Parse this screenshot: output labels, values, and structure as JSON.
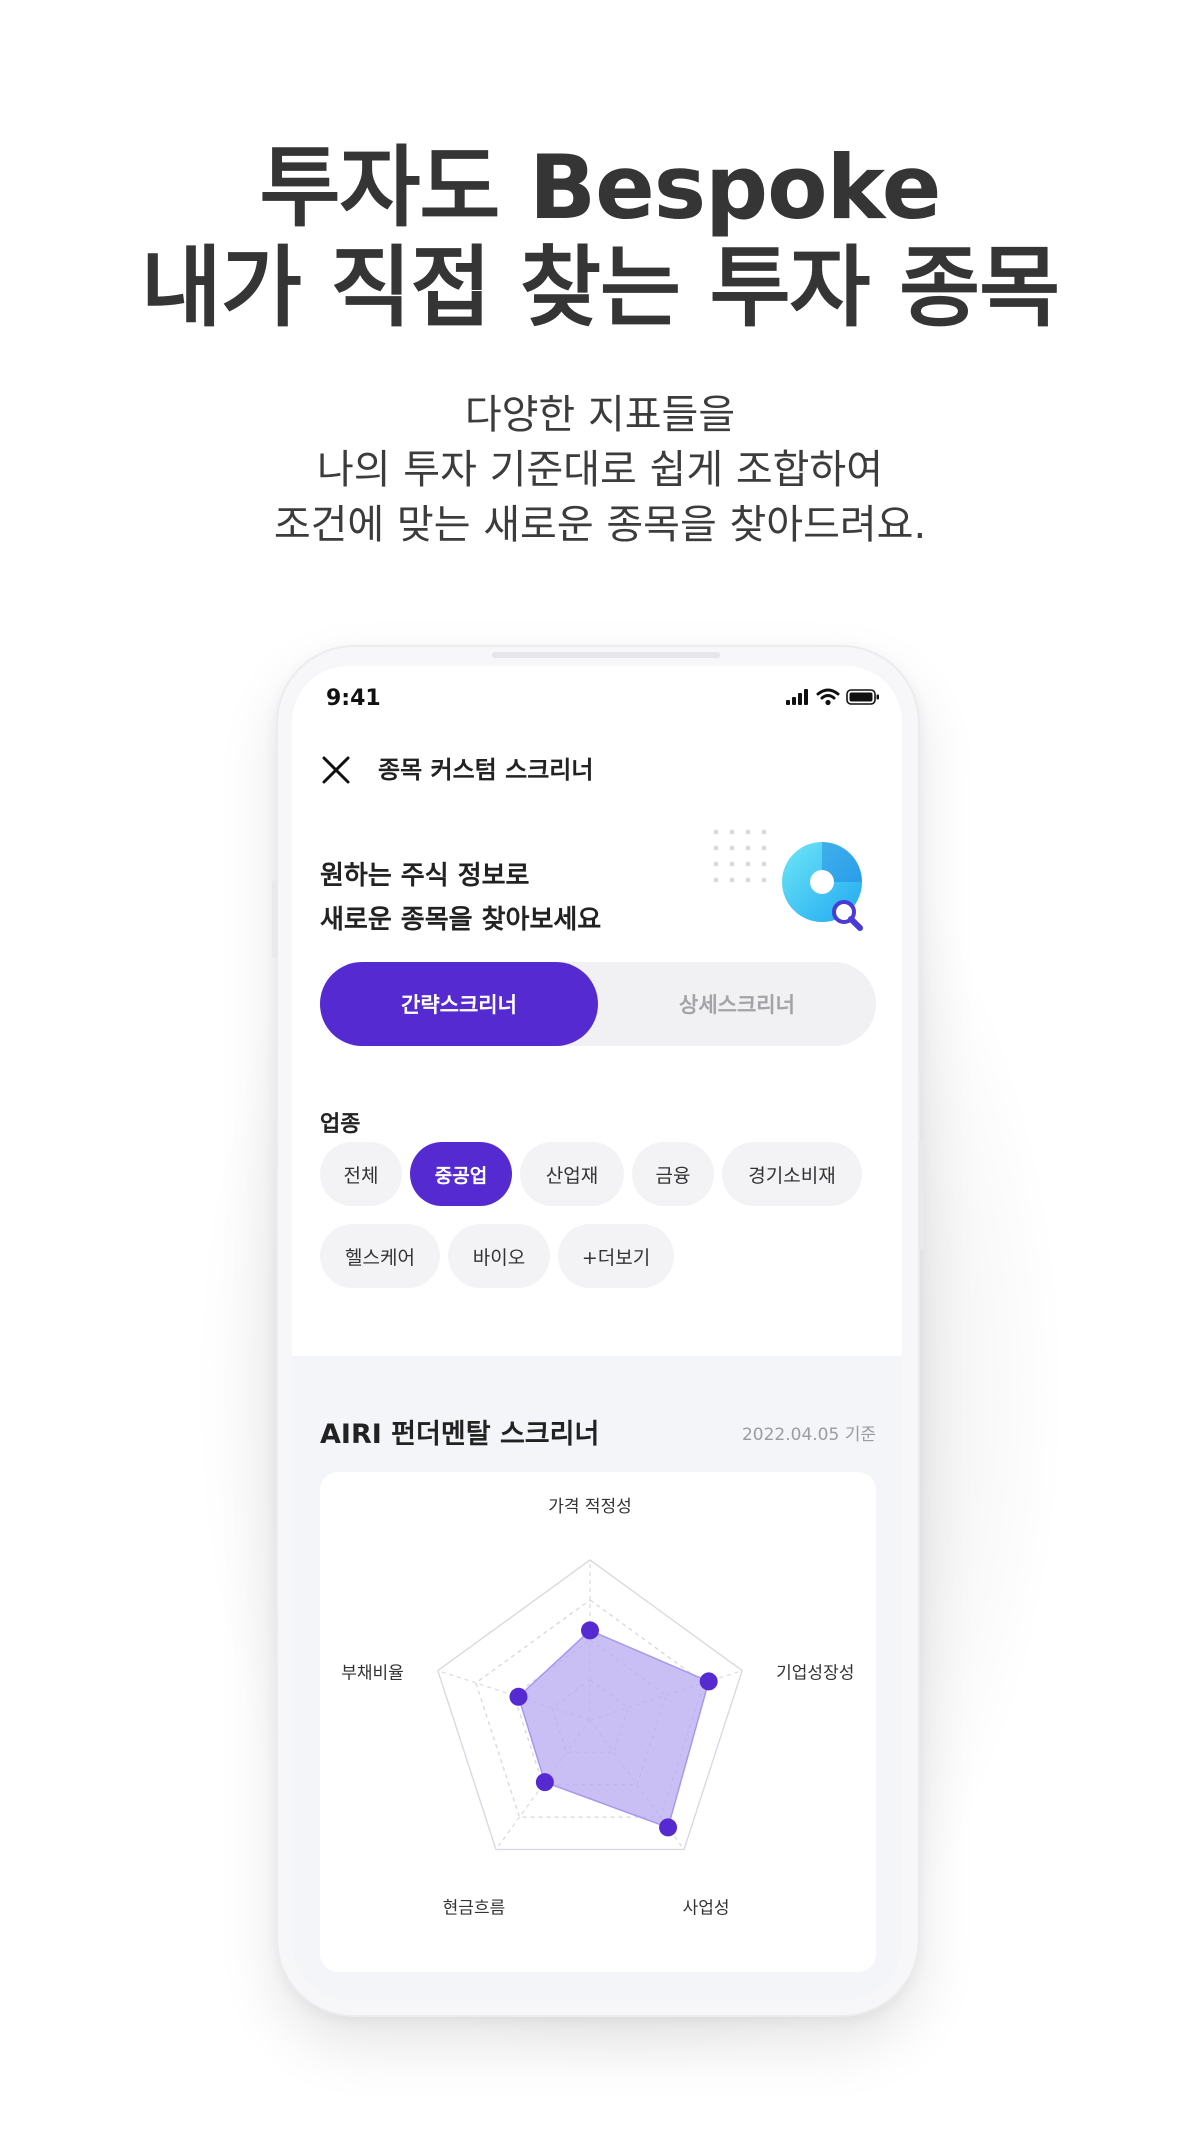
{
  "hero": {
    "title_line1": "투자도 Bespoke",
    "title_line2": "내가 직접 찾는 투자 종목",
    "sub_line1": "다양한 지표들을",
    "sub_line2": "나의 투자 기준대로 쉽게 조합하여",
    "sub_line3": "조건에 맞는 새로운 종목을 찾아드려요."
  },
  "status_bar": {
    "time": "9:41",
    "icons": [
      "signal-icon",
      "wifi-icon",
      "battery-icon"
    ]
  },
  "nav": {
    "close_icon": "close-icon",
    "title": "종목 커스텀 스크리너"
  },
  "intro": {
    "line1": "원하는 주식 정보로",
    "line2": "새로운 종목을 찾아보세요",
    "illustration": "search-magnifier-icon"
  },
  "toggle": {
    "simple_label": "간략스크리너",
    "detail_label": "상세스크리너",
    "active": "simple"
  },
  "category": {
    "label": "업종",
    "chips": [
      "전체",
      "중공업",
      "산업재",
      "금융",
      "경기소비재",
      "헬스케어",
      "바이오",
      "+더보기"
    ],
    "selected": "중공업"
  },
  "fundamental": {
    "title": "AIRI 펀더멘탈 스크리너",
    "date": "2022.04.05 기준"
  },
  "chart_data": {
    "type": "radar",
    "axes": [
      "가격 적정성",
      "기업성장성",
      "사업성",
      "현금흐름",
      "부채비율"
    ],
    "values": [
      0.56,
      0.78,
      0.83,
      0.48,
      0.47
    ],
    "max": 1,
    "grid_levels": 4,
    "colors": {
      "fill": "#b8a9f0",
      "point": "#552bd1",
      "grid": "#d9d9e4"
    }
  },
  "colors": {
    "accent": "#552bd1",
    "chip_bg": "#f3f3f5",
    "section_bg": "#f4f5f8"
  }
}
